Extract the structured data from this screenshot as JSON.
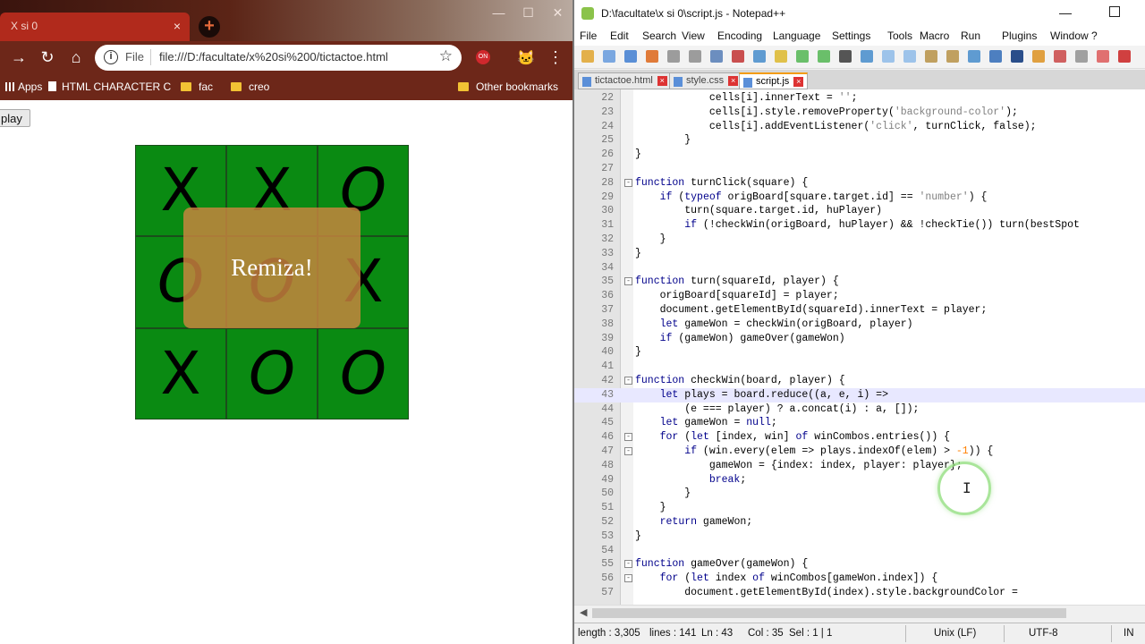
{
  "browser": {
    "tab_title": "X si 0",
    "url_scheme_label": "File",
    "url": "file:///D:/facultate/x%20si%200/tictactoe.html",
    "ext_badge": "ON",
    "bookmarks": [
      "Apps",
      "HTML CHARACTER C",
      "fac",
      "creo"
    ],
    "other_bookmarks": "Other bookmarks"
  },
  "game": {
    "replay_label": "play",
    "cells": [
      "X",
      "X",
      "O",
      "O",
      "O",
      "X",
      "X",
      "O",
      "O"
    ],
    "result_message": "Remiza!"
  },
  "notepad": {
    "title": "D:\\facultate\\x si 0\\script.js - Notepad++",
    "menu": [
      "File",
      "Edit",
      "Search",
      "View",
      "Encoding",
      "Language",
      "Settings",
      "Tools",
      "Macro",
      "Run",
      "Plugins",
      "Window",
      "?"
    ],
    "tabs": [
      "tictactoe.html",
      "style.css",
      "script.js"
    ],
    "active_tab_index": 2,
    "current_line": 43,
    "lines": [
      {
        "n": "22",
        "code": "            cells[i].innerText = '';"
      },
      {
        "n": "23",
        "code": "            cells[i].style.removeProperty('background-color');"
      },
      {
        "n": "24",
        "code": "            cells[i].addEventListener('click', turnClick, false);"
      },
      {
        "n": "25",
        "code": "        }"
      },
      {
        "n": "26",
        "code": "}"
      },
      {
        "n": "27",
        "code": ""
      },
      {
        "n": "28",
        "code": "function turnClick(square) {"
      },
      {
        "n": "29",
        "code": "    if (typeof origBoard[square.target.id] == 'number') {"
      },
      {
        "n": "30",
        "code": "        turn(square.target.id, huPlayer)"
      },
      {
        "n": "31",
        "code": "        if (!checkWin(origBoard, huPlayer) && !checkTie()) turn(bestSpot"
      },
      {
        "n": "32",
        "code": "    }"
      },
      {
        "n": "33",
        "code": "}"
      },
      {
        "n": "34",
        "code": ""
      },
      {
        "n": "35",
        "code": "function turn(squareId, player) {"
      },
      {
        "n": "36",
        "code": "    origBoard[squareId] = player;"
      },
      {
        "n": "37",
        "code": "    document.getElementById(squareId).innerText = player;"
      },
      {
        "n": "38",
        "code": "    let gameWon = checkWin(origBoard, player)"
      },
      {
        "n": "39",
        "code": "    if (gameWon) gameOver(gameWon)"
      },
      {
        "n": "40",
        "code": "}"
      },
      {
        "n": "41",
        "code": ""
      },
      {
        "n": "42",
        "code": "function checkWin(board, player) {"
      },
      {
        "n": "43",
        "code": "    let plays = board.reduce((a, e, i) =>"
      },
      {
        "n": "44",
        "code": "        (e === player) ? a.concat(i) : a, []);"
      },
      {
        "n": "45",
        "code": "    let gameWon = null;"
      },
      {
        "n": "46",
        "code": "    for (let [index, win] of winCombos.entries()) {"
      },
      {
        "n": "47",
        "code": "        if (win.every(elem => plays.indexOf(elem) > -1)) {"
      },
      {
        "n": "48",
        "code": "            gameWon = {index: index, player: player};"
      },
      {
        "n": "49",
        "code": "            break;"
      },
      {
        "n": "50",
        "code": "        }"
      },
      {
        "n": "51",
        "code": "    }"
      },
      {
        "n": "52",
        "code": "    return gameWon;"
      },
      {
        "n": "53",
        "code": "}"
      },
      {
        "n": "54",
        "code": ""
      },
      {
        "n": "55",
        "code": "function gameOver(gameWon) {"
      },
      {
        "n": "56",
        "code": "    for (let index of winCombos[gameWon.index]) {"
      },
      {
        "n": "57",
        "code": "        document.getElementById(index).style.backgroundColor ="
      }
    ],
    "fold_markers": {
      "28": "-",
      "35": "-",
      "42": "-",
      "46": "-",
      "47": "-",
      "55": "-",
      "56": "-"
    },
    "status": {
      "length": "length : 3,305",
      "lines": "lines : 141",
      "ln": "Ln : 43",
      "col": "Col : 35",
      "sel": "Sel : 1 | 1",
      "eol": "Unix (LF)",
      "encoding": "UTF-8",
      "mode": "IN"
    }
  },
  "colors": {
    "board_green": "#0a8a12",
    "overlay_orange": "#cd853f",
    "chrome_toolbar": "#6d2719",
    "tab_red": "#b12a1c"
  },
  "icons": [
    "back-arrow-icon",
    "forward-arrow-icon",
    "reload-icon",
    "home-icon",
    "info-icon",
    "star-icon",
    "menu-dots-icon",
    "folder-icon",
    "close-icon"
  ]
}
